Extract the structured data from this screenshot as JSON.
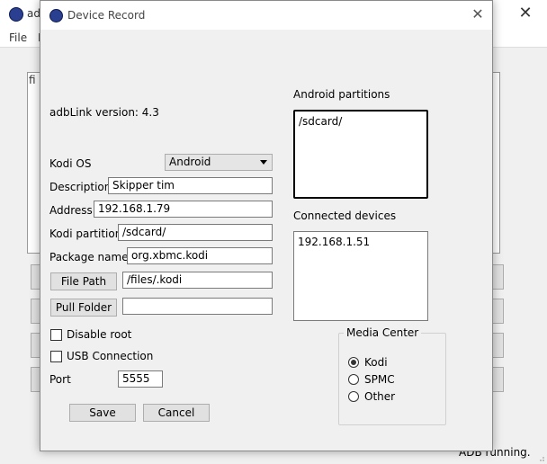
{
  "background": {
    "title_fragment": "ad",
    "menu_file": "File",
    "menu_fragment": "E",
    "table_header_fragment": "fi",
    "status": "ADB running."
  },
  "dialog": {
    "title": "Device Record",
    "version_label": "adbLink version: 4.3",
    "kodi_os_label": "Kodi OS",
    "kodi_os_value": "Android",
    "description_label": "Description",
    "description_value": "Skipper tim",
    "address_label": "Address",
    "address_value": "192.168.1.79",
    "kodi_partition_label": "Kodi partition",
    "kodi_partition_value": "/sdcard/",
    "package_name_label": "Package name",
    "package_name_value": "org.xbmc.kodi",
    "file_path_button": "File Path",
    "file_path_value": "/files/.kodi",
    "pull_folder_button": "Pull Folder",
    "pull_folder_value": "",
    "disable_root_label": "Disable root",
    "usb_connection_label": "USB Connection",
    "port_label": "Port",
    "port_value": "5555",
    "save_button": "Save",
    "cancel_button": "Cancel",
    "android_partitions_label": "Android partitions",
    "android_partitions": [
      "/sdcard/"
    ],
    "connected_devices_label": "Connected devices",
    "connected_devices": [
      "192.168.1.51"
    ],
    "media_center_label": "Media Center",
    "media_center_options": [
      "Kodi",
      "SPMC",
      "Other"
    ],
    "media_center_selected": "Kodi"
  }
}
